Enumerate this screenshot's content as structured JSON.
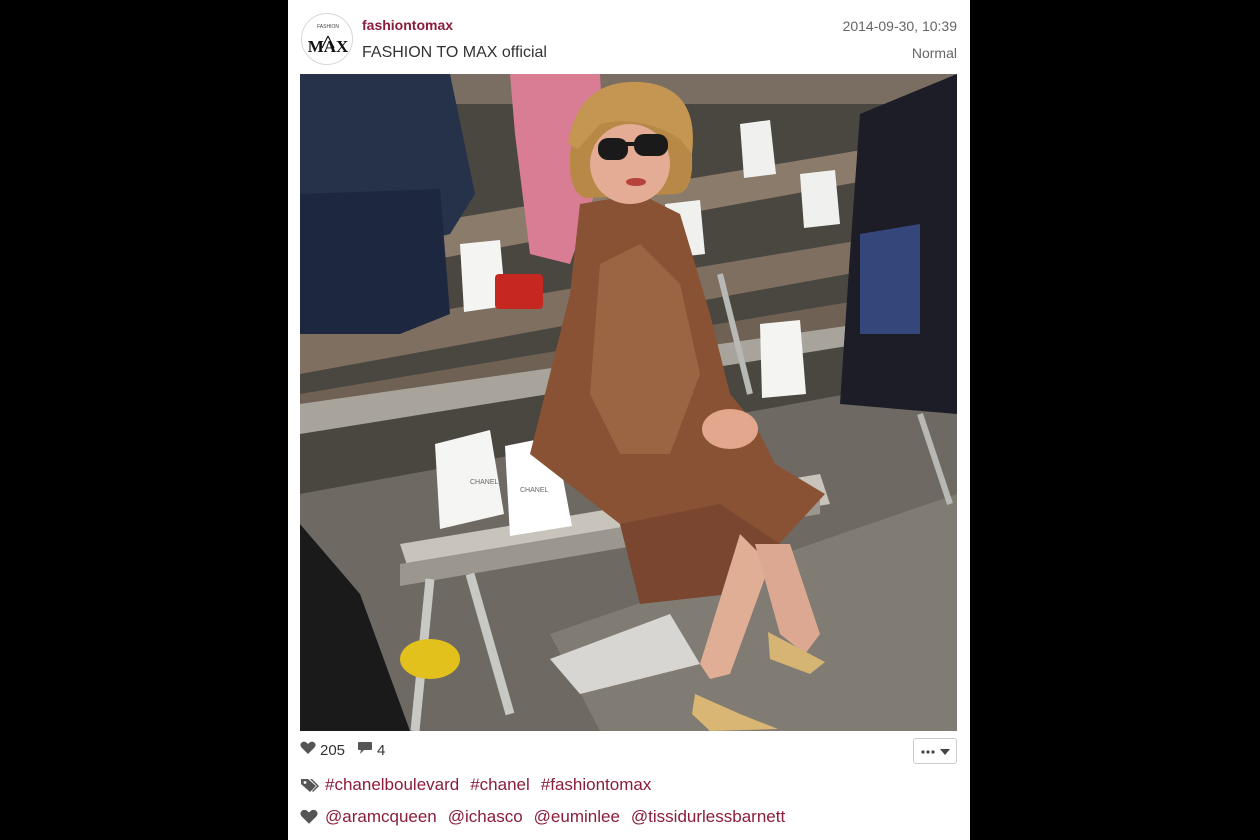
{
  "post": {
    "username": "fashiontomax",
    "full_name": "FASHION TO MAX official",
    "timestamp": "2014-09-30, 10:39",
    "filter": "Normal",
    "avatar_icon": "fashion-to-max-logo",
    "avatar_logo_text_small": "FASHION",
    "avatar_logo_text": "MAX",
    "photo_box_labels": [
      "CHANEL",
      "CHANEL"
    ]
  },
  "stats": {
    "likes": "205",
    "comments": "4",
    "like_icon": "heart-icon",
    "comment_icon": "comment-bubble-icon"
  },
  "actions": {
    "more_icon": "ellipsis-icon",
    "dropdown_icon": "caret-down-icon"
  },
  "hashtags": [
    "#chanelboulevard",
    "#chanel",
    "#fashiontomax"
  ],
  "tagged_users": [
    "@aramcqueen",
    "@ichasco",
    "@euminlee",
    "@tissidurlessbarnett"
  ],
  "colors": {
    "brand": "#8a1d3a",
    "background": "#000000",
    "card": "#ffffff",
    "icon": "#555555"
  }
}
